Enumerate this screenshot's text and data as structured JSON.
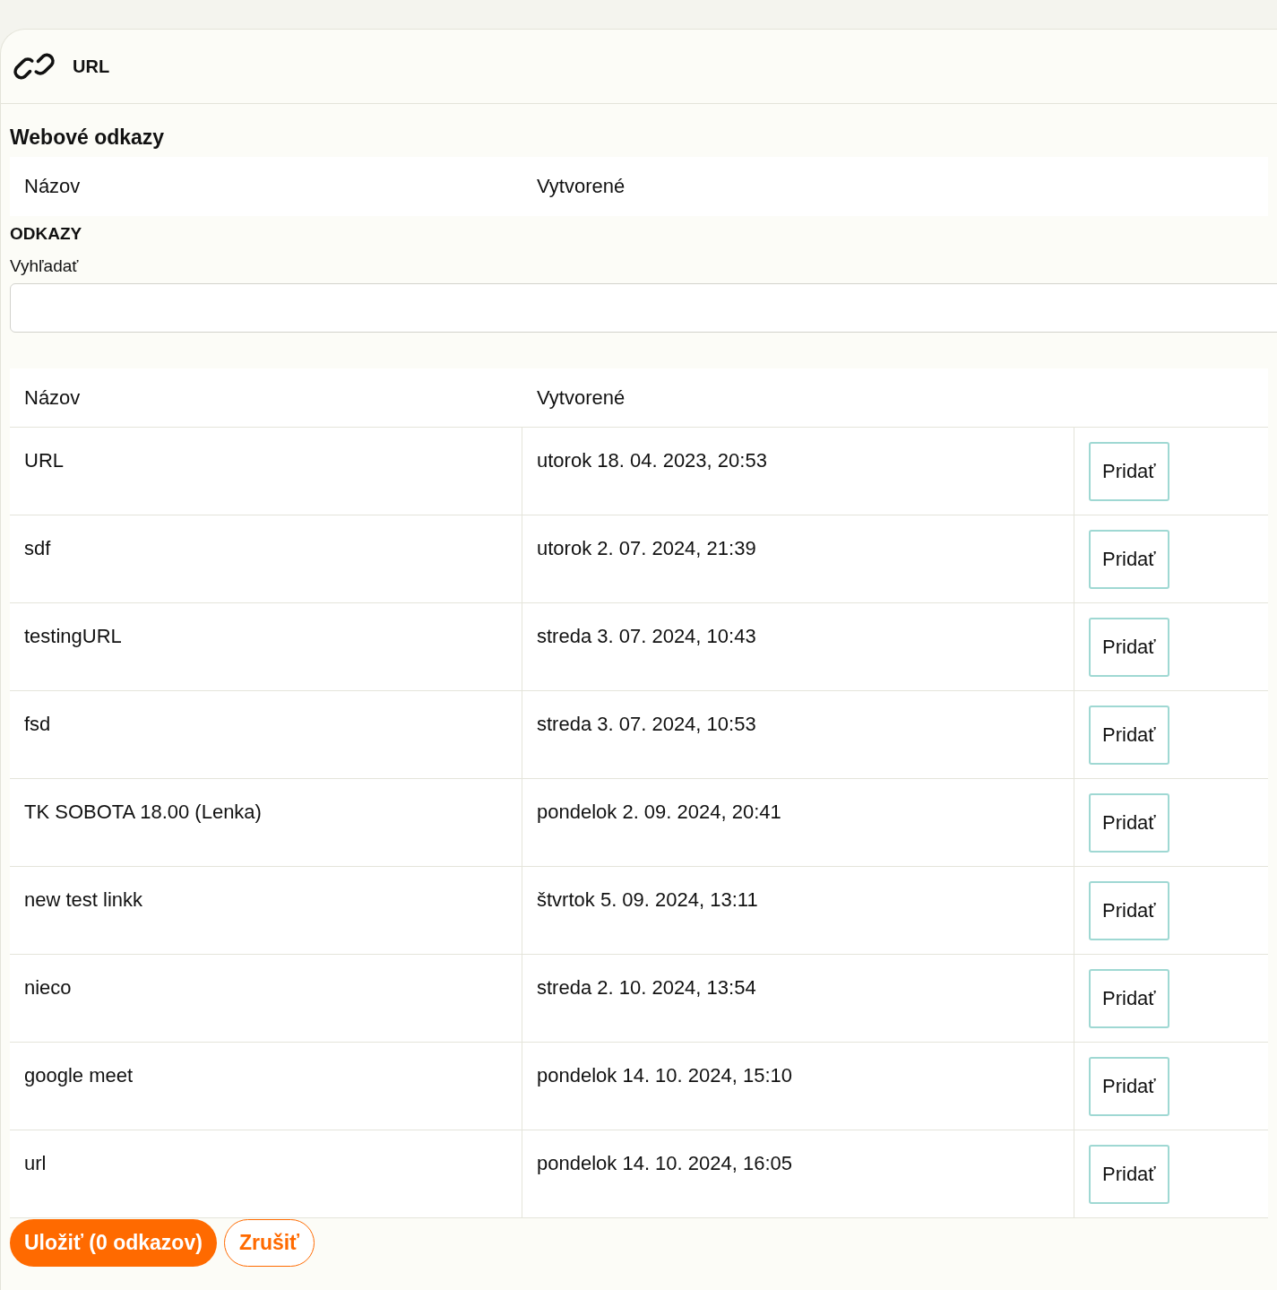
{
  "header": {
    "title": "URL"
  },
  "section_title": "Webové odkazy",
  "summary_columns": [
    "Názov",
    "Vytvorené"
  ],
  "links_label": "ODKAZY",
  "search": {
    "label": "Vyhľadať"
  },
  "table": {
    "columns": [
      "Názov",
      "Vytvorené"
    ],
    "rows": [
      {
        "name": "URL",
        "created": "utorok 18. 04. 2023, 20:53",
        "action": "Pridať"
      },
      {
        "name": "sdf",
        "created": "utorok 2. 07. 2024, 21:39",
        "action": "Pridať"
      },
      {
        "name": "testingURL",
        "created": "streda 3. 07. 2024, 10:43",
        "action": "Pridať"
      },
      {
        "name": "fsd",
        "created": "streda 3. 07. 2024, 10:53",
        "action": "Pridať"
      },
      {
        "name": "TK SOBOTA 18.00 (Lenka)",
        "created": "pondelok 2. 09. 2024, 20:41",
        "action": "Pridať"
      },
      {
        "name": "new test linkk",
        "created": "štvrtok 5. 09. 2024, 13:11",
        "action": "Pridať"
      },
      {
        "name": "nieco",
        "created": "streda 2. 10. 2024, 13:54",
        "action": "Pridať"
      },
      {
        "name": "google meet",
        "created": "pondelok 14. 10. 2024, 15:10",
        "action": "Pridať"
      },
      {
        "name": "url",
        "created": "pondelok 14. 10. 2024, 16:05",
        "action": "Pridať"
      }
    ]
  },
  "buttons": {
    "save": "Uložiť (0 odkazov)",
    "cancel": "Zrušiť"
  }
}
